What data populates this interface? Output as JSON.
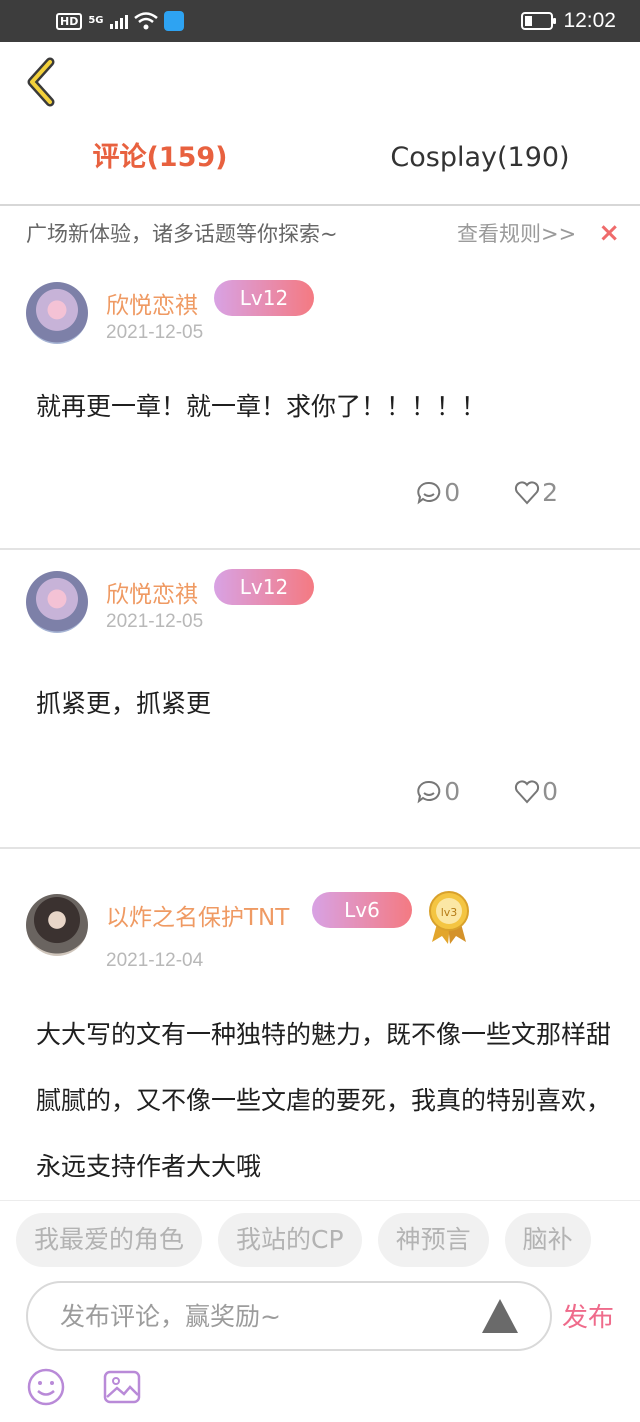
{
  "status_bar": {
    "hd": "HD",
    "network": "5G",
    "time": "12:02"
  },
  "tabs": [
    {
      "label": "评论(159)",
      "active": true
    },
    {
      "label": "Cosplay(190)",
      "active": false
    }
  ],
  "notice": {
    "text": "广场新体验，诸多话题等你探索~",
    "link": "查看规则>>",
    "close": "×"
  },
  "comments": [
    {
      "user": "欣悦恋祺",
      "level": "Lv12",
      "date": "2021-12-05",
      "text": "就再更一章！就一章！求你了！！！！！",
      "replies": "0",
      "likes": "2"
    },
    {
      "user": "欣悦恋祺",
      "level": "Lv12",
      "date": "2021-12-05",
      "text": "抓紧更，抓紧更",
      "replies": "0",
      "likes": "0"
    },
    {
      "user": "以炸之名保护TNT",
      "level": "Lv6",
      "medal": "lv3",
      "date": "2021-12-04",
      "text": "大大写的文有一种独特的魅力，既不像一些文那样甜腻腻的，又不像一些文虐的要死，我真的特别喜欢，永远支持作者大大哦"
    }
  ],
  "topics": [
    "我最爱的角色",
    "我站的CP",
    "神预言",
    "脑补"
  ],
  "composer": {
    "placeholder": "发布评论，赢奖励~",
    "publish": "发布"
  },
  "colors": {
    "accent": "#e8613f",
    "username": "#ef9a63",
    "publish": "#ef6b8b"
  }
}
